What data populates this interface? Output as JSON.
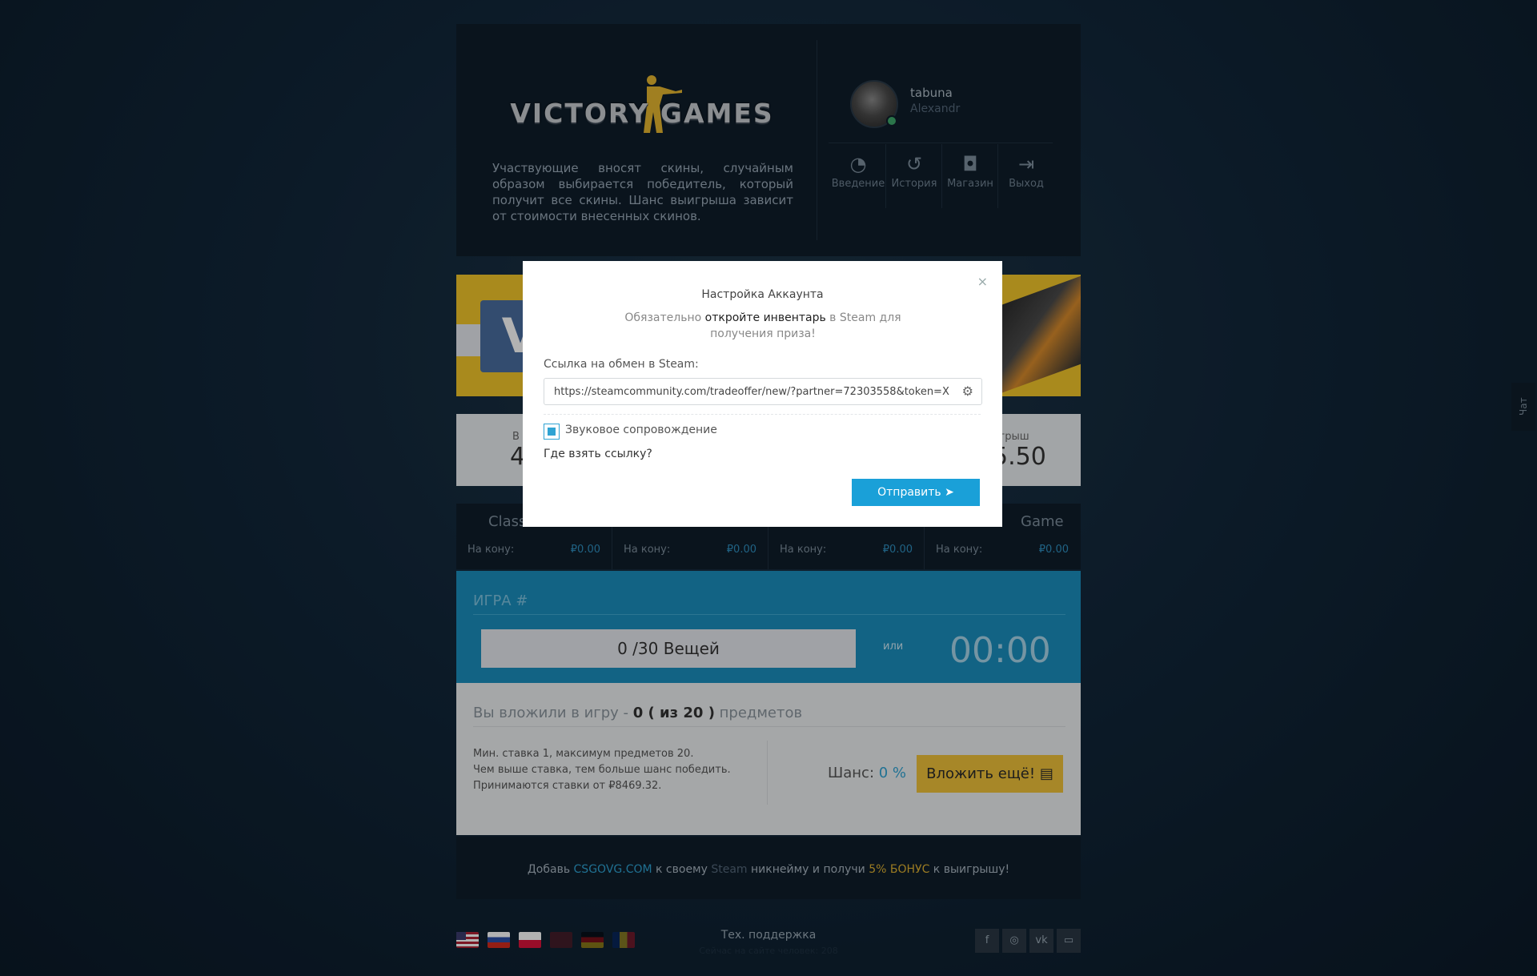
{
  "header": {
    "logo_text": "VICTORY GAMES",
    "intro": "Участвующие вносят скины, случайным образом выбирается победитель, который получит все скины. Шанс выигрыша зависит от стоимости внесенных скинов."
  },
  "user": {
    "username": "tabuna",
    "realname": "Alexandr"
  },
  "nav": [
    {
      "label": "Введение",
      "icon": "gauge-icon"
    },
    {
      "label": "История",
      "icon": "history-icon"
    },
    {
      "label": "Магазин",
      "icon": "shopping-bag-icon"
    },
    {
      "label": "Выход",
      "icon": "sign-out-icon"
    }
  ],
  "stats": {
    "left_label": "В",
    "left_value": "4",
    "right_label": "игрыш",
    "right_value": "5.50"
  },
  "tabs": [
    {
      "name": "Class",
      "label": "На кону:",
      "value": "₽0.00"
    },
    {
      "name": "",
      "label": "На кону:",
      "value": "₽0.00"
    },
    {
      "name": "",
      "label": "На кону:",
      "value": "₽0.00"
    },
    {
      "name": "Game",
      "label": "На кону:",
      "value": "₽0.00"
    }
  ],
  "game": {
    "title": "ИГРА #",
    "progress": "0 /30 Вещей",
    "or": "или",
    "timer": "00:00"
  },
  "bet": {
    "title_prefix": "Вы вложили в игру - ",
    "title_count": "0 ( из 20 )",
    "title_suffix": " предметов",
    "rules": [
      "Мин. ставка 1, максимум предметов 20.",
      "Чем выше ставка, тем больше шанс победить.",
      "Принимаются ставки от ₽8469.32."
    ],
    "chance_label": "Шанс:",
    "chance_value": "0 %",
    "deposit_button": "Вложить ещё!"
  },
  "promo": {
    "t1": "Добавь ",
    "site": "CSGOVG.COM",
    "t2": " к своему ",
    "steam": "Steam",
    "t3": " никнейму и получи ",
    "bonus": "5% БОНУС",
    "t4": " к выигрышу!"
  },
  "footer": {
    "support": "Тех. поддержка",
    "online": "Сейчас на сайте человек: 208"
  },
  "chat": {
    "label": "Чат"
  },
  "modal": {
    "title": "Настройка Аккаунта",
    "desc_prefix": "Обязательно ",
    "desc_link": "откройте инвентарь",
    "desc_suffix": " в Steam для получения приза!",
    "link_label": "Ссылка на обмен в Steam:",
    "link_value": "https://steamcommunity.com/tradeoffer/new/?partner=72303558&token=X",
    "sound_label": "Звуковое сопровождение",
    "where_link": "Где взять ссылку?",
    "send_button": "Отправить",
    "close": "×"
  },
  "colors": {
    "accent": "#1aa0d8",
    "game_panel": "#1a8fbe",
    "deposit": "#f0c23a",
    "bonus": "#e0b232"
  }
}
